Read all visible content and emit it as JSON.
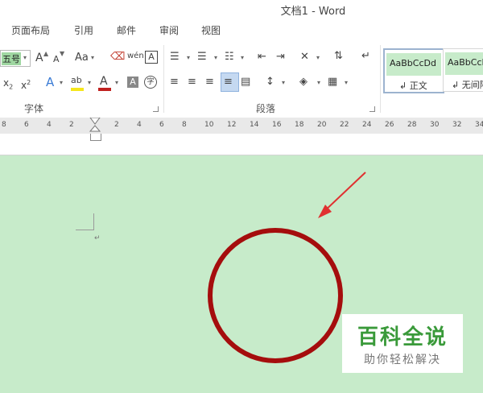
{
  "window": {
    "title": "文档1 - Word"
  },
  "tabs": [
    "页面布局",
    "引用",
    "邮件",
    "审阅",
    "视图"
  ],
  "font": {
    "size_value": "五号",
    "grow_label": "A",
    "shrink_label": "A",
    "case_label": "Aa",
    "phonetic_label": "wén",
    "border_char_label": "A",
    "subscript_label": "x",
    "superscript_label": "x",
    "text_effect_label": "A",
    "highlight_label": "ab",
    "font_color_label": "A",
    "shading_label": "A",
    "enclose_label": "字",
    "group_label": "字体"
  },
  "paragraph": {
    "group_label": "段落"
  },
  "styles": {
    "items": [
      {
        "preview": "AaBbCcDd",
        "name": "正文"
      },
      {
        "preview": "AaBbCcI",
        "name": "无间隔"
      }
    ]
  },
  "ruler": {
    "ticks": [
      "8",
      "6",
      "4",
      "2",
      "2",
      "4",
      "6",
      "8",
      "10",
      "12",
      "14",
      "16",
      "18",
      "20",
      "22",
      "24",
      "26",
      "28",
      "30",
      "32",
      "34"
    ]
  },
  "watermark": {
    "title": "百科全说",
    "subtitle": "助你轻松解决"
  },
  "colors": {
    "doc_background": "#c7ebca",
    "annotation": "#a50d0d",
    "arrow": "#e03030",
    "watermark_green": "#3a9a3a"
  }
}
